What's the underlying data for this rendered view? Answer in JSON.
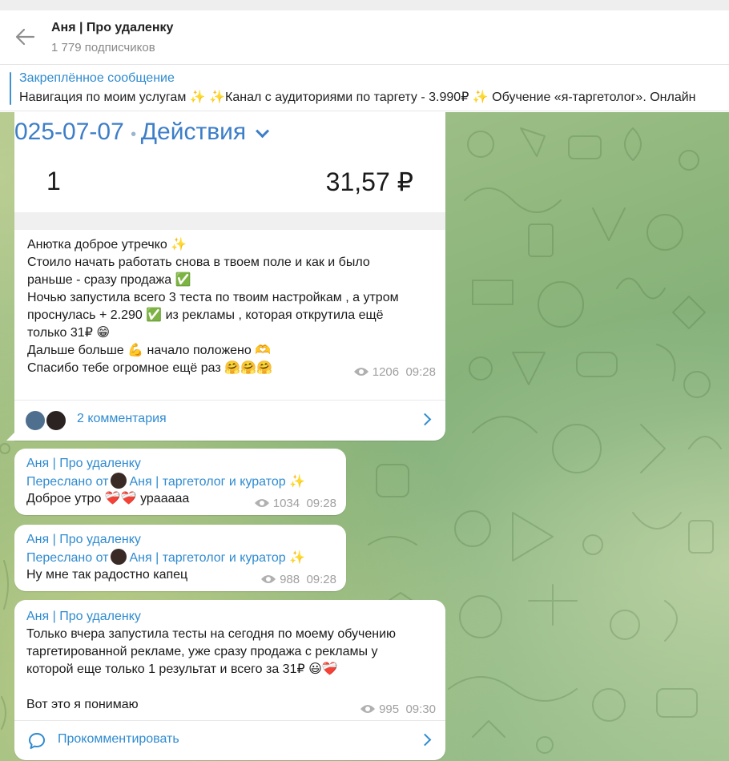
{
  "header": {
    "title": "Аня | Про удаленку",
    "subscribers": "1 779 подписчиков"
  },
  "pinned": {
    "title": "Закреплённое сообщение",
    "text": "Навигация по моим услугам ✨  ✨Канал с аудиториями по таргету - 3.990₽ ✨ Обучение «я-таргетолог». Онлайн"
  },
  "messages": [
    {
      "receipt": {
        "date": "025-07-07",
        "action": "Действия",
        "qty": "1",
        "sum": "31,57 ₽"
      },
      "lines": [
        "Анютка доброе утречко ✨",
        "Стоило начать работать снова в твоем поле и как и было",
        "раньше - сразу продажа ✅",
        "Ночью запустила всего 3 теста по твоим настройкам , а утром",
        "проснулась + 2.290 ✅ из рекламы , которая открутила ещё",
        "только 31₽ 😁",
        "Дальше больше 💪 начало положено 🫶",
        "Спасибо тебе огромное ещё раз 🤗🤗🤗"
      ],
      "views": "1206",
      "time": "09:28",
      "comments_label": "2 комментария"
    },
    {
      "author": "Аня | Про удаленку",
      "forwarded_prefix": "Переслано от",
      "forwarded_from": "Аня | таргетолог и куратор ✨",
      "text": "Доброе утро ❤️‍🩹❤️‍🩹 урааааа",
      "views": "1034",
      "time": "09:28"
    },
    {
      "author": "Аня | Про удаленку",
      "forwarded_prefix": "Переслано от",
      "forwarded_from": "Аня | таргетолог и куратор ✨",
      "text": "Ну мне так радостно капец",
      "views": "988",
      "time": "09:28"
    },
    {
      "author": "Аня | Про удаленку",
      "lines": [
        "Только вчера запустила тесты на сегодня по моему обучению",
        "таргетированной рекламе, уже сразу продажа с рекламы у",
        "которой еще только 1 результат и всего за 31₽ 😃❤️‍🩹",
        "",
        "Вот это я понимаю"
      ],
      "views": "995",
      "time": "09:30",
      "comments_label": "Прокомментировать"
    }
  ],
  "colors": {
    "accent": "#2f8bd0",
    "chat_bg": "#8cb57b",
    "bubble": "#ffffff"
  },
  "icons": [
    "back-arrow-icon",
    "eye-icon",
    "chevron-down-icon",
    "chevron-right-icon",
    "comment-icon"
  ]
}
